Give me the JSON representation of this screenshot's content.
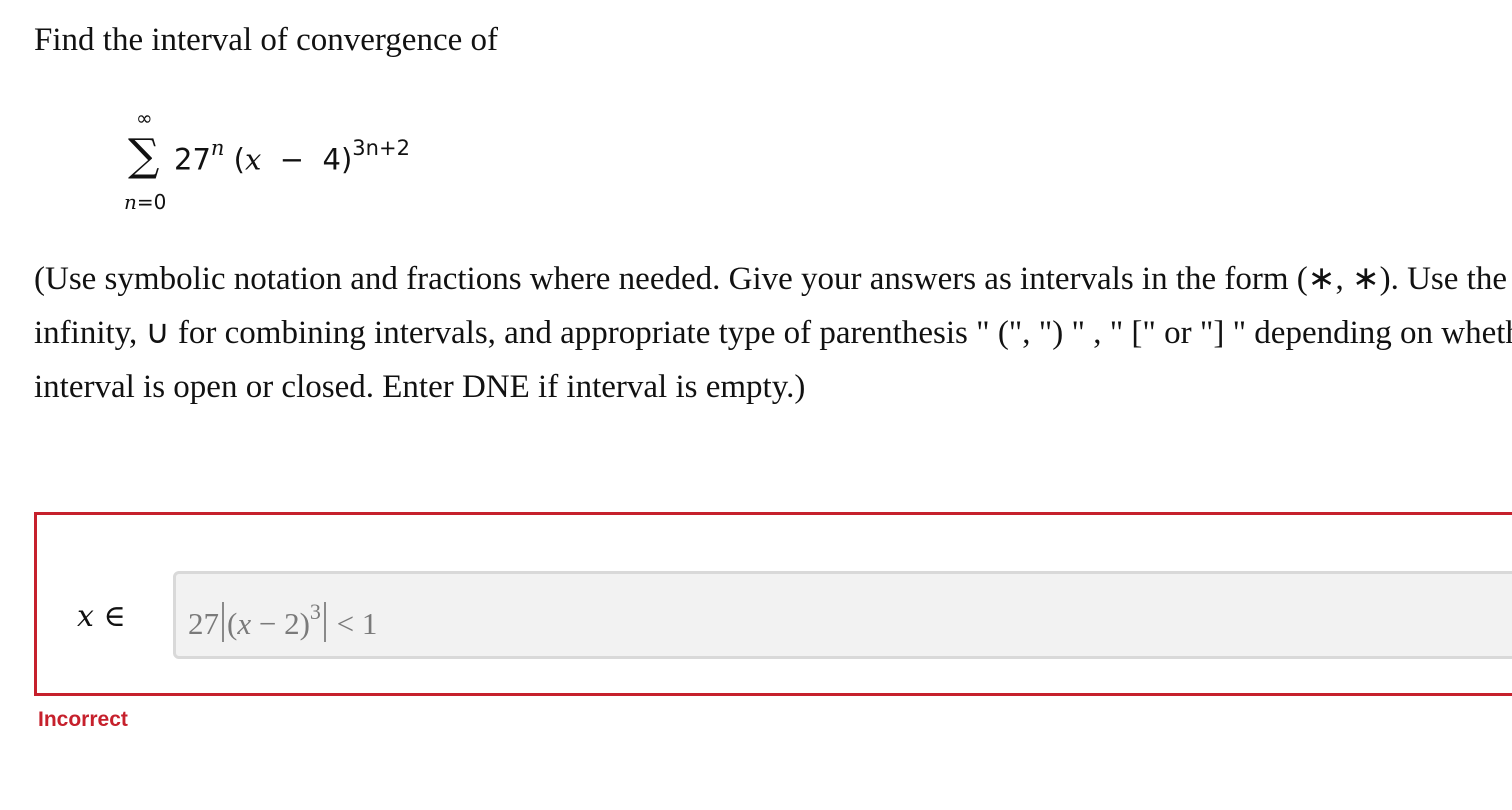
{
  "question": {
    "prompt": "Find the interval of convergence of",
    "series": {
      "upper_limit": "∞",
      "sigma": "∑",
      "coefficient": "27",
      "coefficient_exponent": "n",
      "open_paren": "(",
      "variable": "x",
      "operator": "−",
      "center": "4)",
      "exponent": "3n+2",
      "lower_index_var": "n",
      "lower_index_rest": "=0"
    },
    "instructions": [
      "(Use symbolic notation and fractions where needed. Give your answers as intervals in the form (∗, ∗). Use the symbol ∞ for",
      "infinity, ∪ for combining intervals, and appropriate type of parenthesis \" (\", \") \" ,   \" [\" or \"] \" depending on whether the",
      "interval is open or closed. Enter DNE if interval is empty.)"
    ]
  },
  "answer": {
    "label_var": "x",
    "label_symbol": "∈",
    "value": {
      "coefficient": "27",
      "open": "(",
      "variable": "x",
      "minus": " − 2)",
      "power": "3",
      "relation": "< 1"
    },
    "feedback": "Incorrect"
  },
  "colors": {
    "error": "#c6202c",
    "input_bg": "#f2f2f2",
    "input_border": "#d9d9d9"
  }
}
